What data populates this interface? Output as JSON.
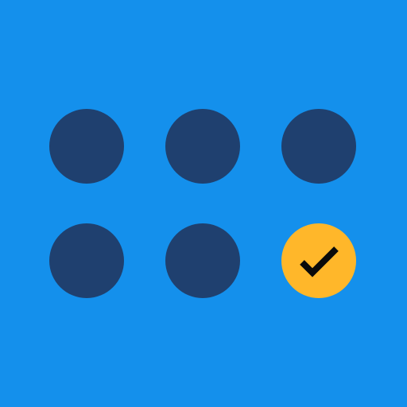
{
  "app": {
    "background_color": "#1490EC",
    "dot_color": "#1F406F",
    "selected_color": "#FFB72A",
    "check_color": "#0A0A0A"
  },
  "grid": {
    "rows": 2,
    "cols": 3,
    "items": [
      {
        "selected": false
      },
      {
        "selected": false
      },
      {
        "selected": false
      },
      {
        "selected": false
      },
      {
        "selected": false
      },
      {
        "selected": true,
        "icon": "checkmark-icon"
      }
    ]
  }
}
